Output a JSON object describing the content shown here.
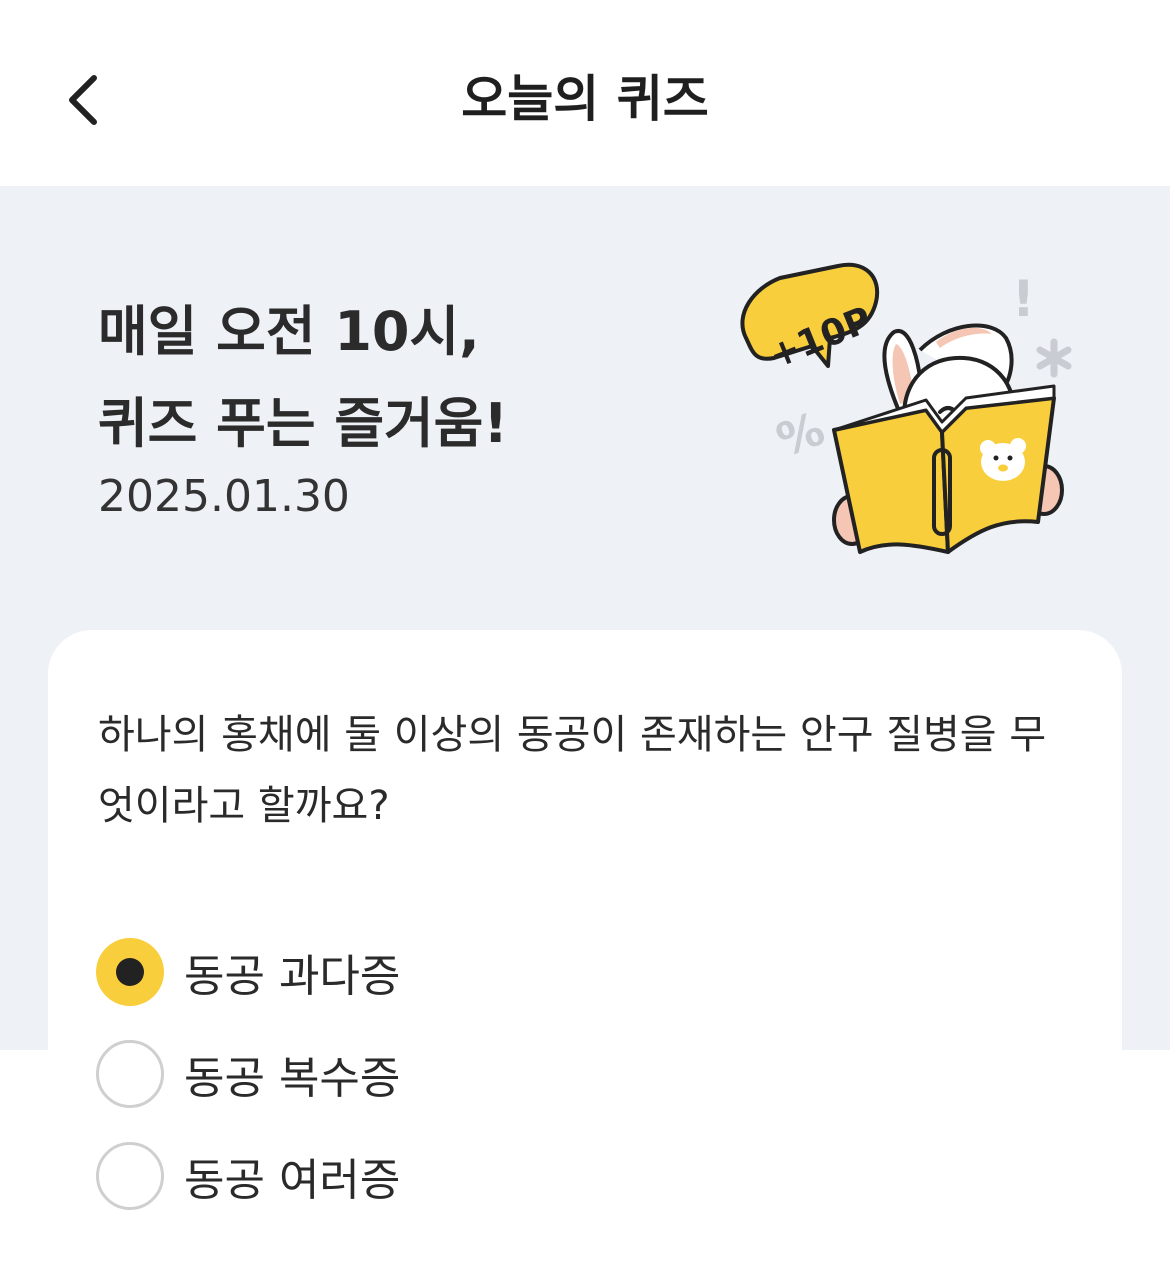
{
  "header": {
    "back_icon": "chevron-left-icon",
    "title": "오늘의 퀴즈"
  },
  "hero": {
    "title_line1": "매일 오전 10시,",
    "title_line2": "퀴즈 푸는 즐거움!",
    "date": "2025.01.30",
    "badge": "+10P",
    "exclamation": "!",
    "percent": "%"
  },
  "quiz": {
    "question": "하나의 홍채에 둘 이상의 동공이 존재하는 안구 질병을 무엇이라고 할까요?",
    "options": [
      {
        "label": "동공 과다증",
        "selected": true
      },
      {
        "label": "동공 복수증",
        "selected": false
      },
      {
        "label": "동공 여러증",
        "selected": false
      }
    ]
  },
  "colors": {
    "accent": "#f9ce3c",
    "hero_bg": "#eef1f6",
    "text": "#222222",
    "radio_border": "#cfcfcf"
  }
}
